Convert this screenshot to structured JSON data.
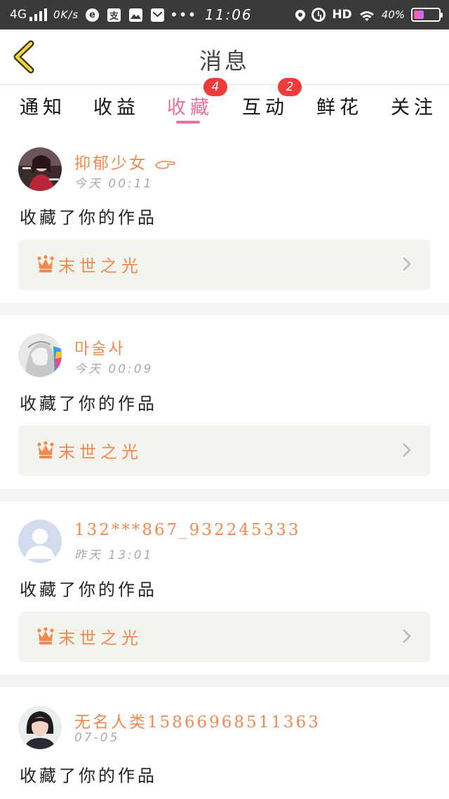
{
  "status_bar": {
    "network": "4G",
    "speed": "0K/s",
    "app_icons": [
      "edge-browser-icon",
      "alipay-icon",
      "photos-app-icon",
      "mail-app-icon"
    ],
    "more": "•••",
    "time": "11:06",
    "hd": "HD",
    "battery_text": "40%",
    "battery_level": 0.4
  },
  "header": {
    "back_icon": "chevron-left-icon",
    "title": "消息"
  },
  "tabs": [
    {
      "label": "通知"
    },
    {
      "label": "收益"
    },
    {
      "label": "收藏",
      "badge": "4",
      "active": true
    },
    {
      "label": "互动",
      "badge": "2"
    },
    {
      "label": "鲜花"
    },
    {
      "label": "关注"
    }
  ],
  "messages": [
    {
      "username": "抑郁少女",
      "name_icon": "pointing-hand-icon",
      "time": "今天 00:11",
      "action": "收藏了你的作品",
      "work_title": "末世之光",
      "work_icon": "crown-icon"
    },
    {
      "username": "마술사",
      "time": "今天 00:09",
      "action": "收藏了你的作品",
      "work_title": "末世之光",
      "work_icon": "crown-icon"
    },
    {
      "username": "132***867_932245333",
      "time": "昨天 13:01",
      "action": "收藏了你的作品",
      "work_title": "末世之光",
      "work_icon": "crown-icon"
    },
    {
      "username": "无名人类15866968511363",
      "time": "07-05",
      "action": "收藏了你的作品"
    }
  ],
  "colors": {
    "accent_pink": "#e8729a",
    "username_orange": "#f08a50",
    "badge_red": "#ee3b3b",
    "status_bar_bg": "#3a3a3a"
  }
}
